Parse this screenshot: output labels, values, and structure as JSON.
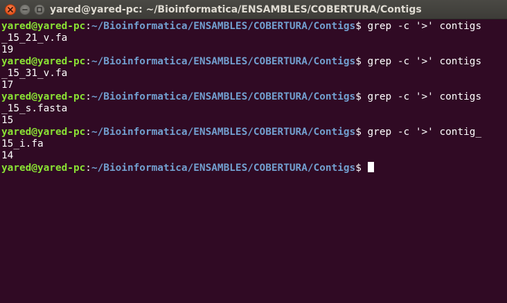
{
  "window": {
    "title": "yared@yared-pc: ~/Bioinformatica/ENSAMBLES/COBERTURA/Contigs",
    "buttons": {
      "close": "close-icon",
      "minimize": "minimize-icon",
      "maximize": "maximize-icon"
    }
  },
  "colors": {
    "background": "#300a24",
    "user_host": "#8ae234",
    "path": "#729fcf",
    "text": "#ffffff"
  },
  "prompt": {
    "user_host": "yared@yared-pc",
    "colon": ":",
    "path": "~/Bioinformatica/ENSAMBLES/COBERTURA/Contigs",
    "symbol": "$ "
  },
  "lines": [
    {
      "type": "prompt",
      "command": "grep -c '>' contigs"
    },
    {
      "type": "output",
      "text": "_15_21_v.fa"
    },
    {
      "type": "output",
      "text": "19"
    },
    {
      "type": "prompt",
      "command": "grep -c '>' contigs"
    },
    {
      "type": "output",
      "text": "_15_31_v.fa"
    },
    {
      "type": "output",
      "text": "17"
    },
    {
      "type": "prompt",
      "command": "grep -c '>' contigs"
    },
    {
      "type": "output",
      "text": "_15_s.fasta"
    },
    {
      "type": "output",
      "text": "15"
    },
    {
      "type": "prompt",
      "command": "grep -c '>' contig_"
    },
    {
      "type": "output",
      "text": "15_i.fa"
    },
    {
      "type": "output",
      "text": "14"
    },
    {
      "type": "prompt",
      "command": ""
    }
  ]
}
